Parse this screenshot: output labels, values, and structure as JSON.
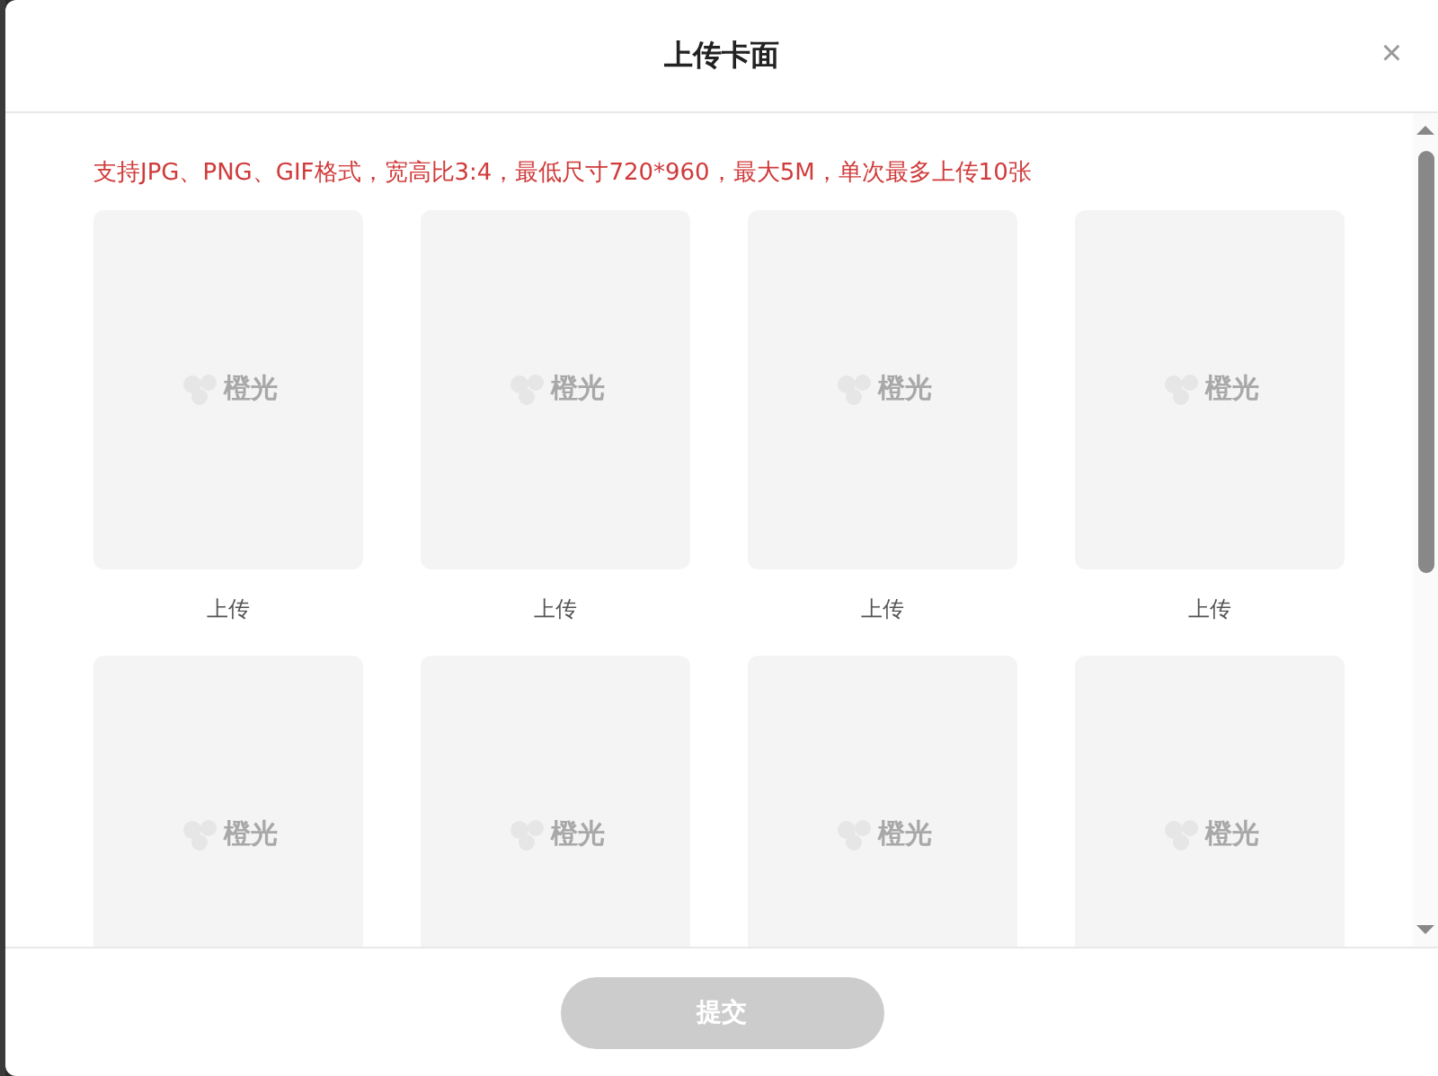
{
  "dialog": {
    "title": "上传卡面",
    "close": "×"
  },
  "notice": "支持JPG、PNG、GIF格式，宽高比3:4，最低尺寸720*960，最大5M，单次最多上传10张",
  "cards": [
    {
      "logo_text": "橙光",
      "label": "上传"
    },
    {
      "logo_text": "橙光",
      "label": "上传"
    },
    {
      "logo_text": "橙光",
      "label": "上传"
    },
    {
      "logo_text": "橙光",
      "label": "上传"
    },
    {
      "logo_text": "橙光"
    },
    {
      "logo_text": "橙光"
    },
    {
      "logo_text": "橙光"
    },
    {
      "logo_text": "橙光"
    }
  ],
  "submit": {
    "label": "提交",
    "disabled": true
  }
}
